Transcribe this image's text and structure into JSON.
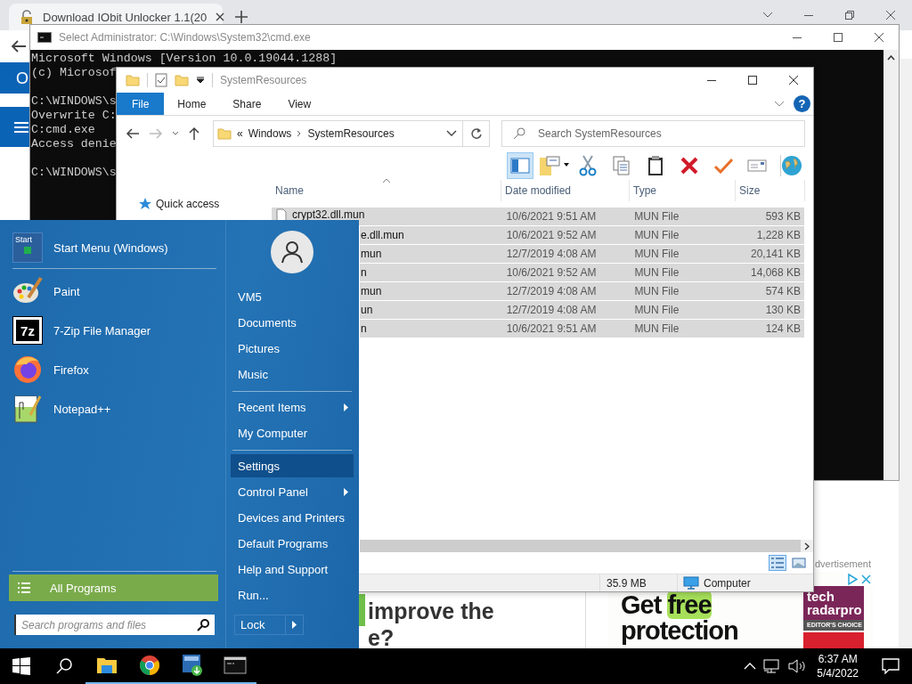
{
  "browser": {
    "tab": {
      "title": "Download IObit Unlocker 1.1(20"
    },
    "site_fragment": "O",
    "article_lines": [
      "improve the",
      "e?"
    ],
    "ad_label": "dvertisement",
    "ad": {
      "headline_lines": [
        [
          {
            "text": "Get",
            "highlight": false
          },
          {
            "text": "free",
            "highlight": true
          }
        ],
        [
          {
            "text": "protection",
            "highlight": false
          }
        ]
      ],
      "badge_lines": [
        "tech",
        "**radar**pro",
        "EDITOR'S CHOICE"
      ]
    }
  },
  "console": {
    "title": "Select Administrator: C:\\Windows\\System32\\cmd.exe",
    "blocks": [
      [
        "Microsoft Windows [Version 10.0.19044.1288]",
        "(c) Microsof"
      ],
      [
        "C:\\WINDOWS\\s",
        "Overwrite C:",
        "C:cmd.exe",
        "Access denie"
      ],
      [
        "C:\\WINDOWS\\s"
      ]
    ]
  },
  "explorer": {
    "title": "SystemResources",
    "ribbon_tabs": [
      {
        "label": "File",
        "selected": true
      },
      {
        "label": "Home",
        "selected": false
      },
      {
        "label": "Share",
        "selected": false
      },
      {
        "label": "View",
        "selected": false
      }
    ],
    "help": "?",
    "address": {
      "overflow": "«",
      "segments": [
        "Windows",
        "SystemResources"
      ]
    },
    "search": {
      "placeholder": "Search SystemResources"
    },
    "toolbar": [
      {
        "kind": "preview_pane",
        "selected": true
      },
      {
        "kind": "properties",
        "selected": false
      },
      {
        "kind": "cut",
        "selected": false
      },
      {
        "kind": "copy",
        "selected": false
      },
      {
        "kind": "paste",
        "selected": false
      },
      {
        "kind": "delete",
        "selected": false
      },
      {
        "kind": "check",
        "selected": false
      },
      {
        "kind": "mail",
        "selected": false
      },
      {
        "kind": "globe",
        "selected": false
      }
    ],
    "nav_items": [
      {
        "label": "Quick access"
      }
    ],
    "columns": [
      "Name",
      "Date modified",
      "Type",
      "Size"
    ],
    "files": [
      {
        "name": "crypt32.dll.mun",
        "kind": "full",
        "date": "10/6/2021 9:51 AM",
        "type": "MUN File",
        "size": "593 KB",
        "selected": true
      },
      {
        "name": "e.dll.mun",
        "kind": "cut",
        "date": "10/6/2021 9:52 AM",
        "type": "MUN File",
        "size": "1,228 KB",
        "selected": true
      },
      {
        "name": "mun",
        "kind": "cut",
        "date": "12/7/2019 4:08 AM",
        "type": "MUN File",
        "size": "20,141 KB",
        "selected": true
      },
      {
        "name": "n",
        "kind": "cut",
        "date": "10/6/2021 9:52 AM",
        "type": "MUN File",
        "size": "14,068 KB",
        "selected": true
      },
      {
        "name": "mun",
        "kind": "cut",
        "date": "12/7/2019 4:08 AM",
        "type": "MUN File",
        "size": "574 KB",
        "selected": true
      },
      {
        "name": "un",
        "kind": "cut",
        "date": "12/7/2019 4:08 AM",
        "type": "MUN File",
        "size": "130 KB",
        "selected": true
      },
      {
        "name": "n",
        "kind": "cut",
        "date": "10/6/2021 9:51 AM",
        "type": "MUN File",
        "size": "124 KB",
        "selected": true
      }
    ],
    "view_modes": [
      {
        "kind": "details",
        "selected": true
      },
      {
        "kind": "large_icons",
        "selected": false
      }
    ],
    "status": {
      "size": "35.9 MB",
      "zone": "Computer"
    }
  },
  "start_menu": {
    "pinned": [
      {
        "label": "Start Menu (Windows)",
        "kind": "start_menu",
        "badge": "Start"
      },
      {
        "label": "Paint",
        "kind": "paint"
      },
      {
        "label": "7-Zip File Manager",
        "kind": "sevenzip",
        "badge": "7z"
      },
      {
        "label": "Firefox",
        "kind": "firefox"
      },
      {
        "label": "Notepad++",
        "kind": "notepad"
      }
    ],
    "all_programs": "All Programs",
    "search": {
      "placeholder": "Search programs and files"
    },
    "place_groups": [
      [
        {
          "label": "VM5",
          "submenu": false,
          "selected": false
        },
        {
          "label": "Documents",
          "submenu": false,
          "selected": false
        },
        {
          "label": "Pictures",
          "submenu": false,
          "selected": false
        },
        {
          "label": "Music",
          "submenu": false,
          "selected": false
        }
      ],
      [
        {
          "label": "Recent Items",
          "submenu": true,
          "selected": false
        },
        {
          "label": "My Computer",
          "submenu": false,
          "selected": false
        }
      ],
      [
        {
          "label": "Settings",
          "submenu": false,
          "selected": true
        },
        {
          "label": "Control Panel",
          "submenu": true,
          "selected": false
        },
        {
          "label": "Devices and Printers",
          "submenu": false,
          "selected": false
        },
        {
          "label": "Default Programs",
          "submenu": false,
          "selected": false
        },
        {
          "label": "Help and Support",
          "submenu": false,
          "selected": false
        },
        {
          "label": "Run...",
          "submenu": false,
          "selected": false
        }
      ]
    ],
    "lock": "Lock"
  },
  "taskbar": {
    "apps": [
      {
        "kind": "explorer",
        "running": true
      },
      {
        "kind": "chrome",
        "running": true
      },
      {
        "kind": "installer",
        "running": true
      },
      {
        "kind": "console",
        "running": true
      }
    ],
    "clock": {
      "time": "6:37 AM",
      "date": "5/4/2022"
    }
  }
}
